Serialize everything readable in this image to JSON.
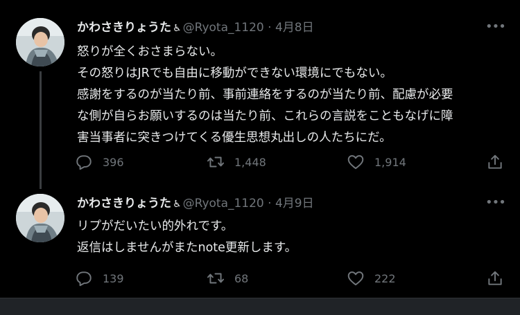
{
  "tweets": [
    {
      "display_name": "かわさきりょうた",
      "accessibility_glyph": "♿",
      "handle": "@Ryota_1120",
      "separator": "·",
      "date": "4月8日",
      "more_glyph": "•••",
      "lines": [
        "怒りが全くおさまらない。",
        "その怒りはJRでも自由に移動ができない環境にでもない。",
        "感謝をするのが当たり前、事前連絡をするのが当たり前、配慮が必要",
        "な側が自らお願いするのは当たり前、これらの言説をこともなげに障",
        "害当事者に突きつけてくる優生思想丸出しの人たちにだ。"
      ],
      "replies": "396",
      "retweets": "1,448",
      "likes": "1,914"
    },
    {
      "display_name": "かわさきりょうた",
      "accessibility_glyph": "♿",
      "handle": "@Ryota_1120",
      "separator": "·",
      "date": "4月9日",
      "more_glyph": "•••",
      "lines": [
        "リプがだいたい的外れです。",
        "返信はしませんがまたnote更新します。"
      ],
      "replies": "139",
      "retweets": "68",
      "likes": "222"
    }
  ],
  "icons": {
    "reply": "reply-icon",
    "retweet": "retweet-icon",
    "like": "heart-icon",
    "share": "share-icon"
  },
  "colors": {
    "background": "#000000",
    "text": "#e7e9ea",
    "muted": "#71767b",
    "thread_line": "#3a3d40"
  }
}
